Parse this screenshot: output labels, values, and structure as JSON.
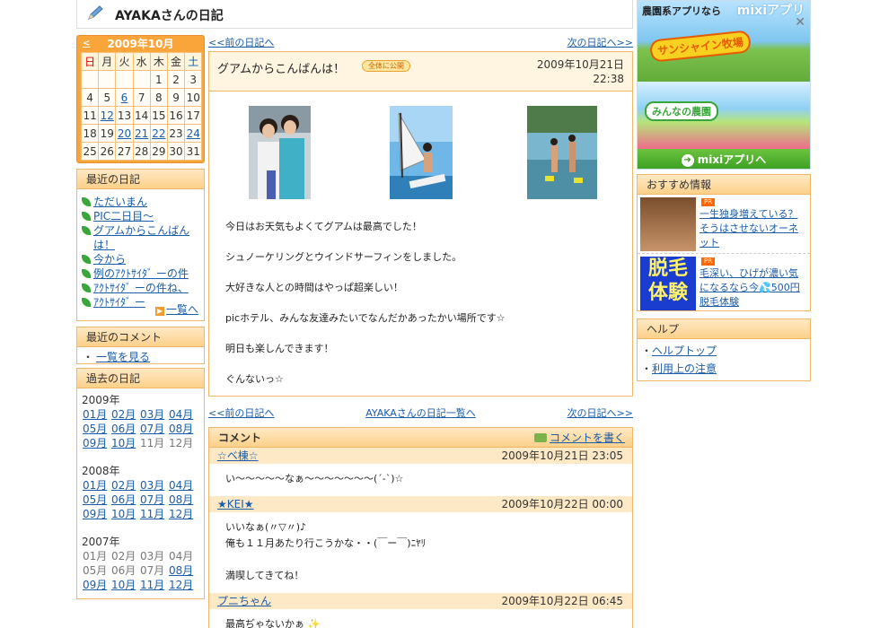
{
  "header": {
    "title": "AYAKAさんの日記"
  },
  "calendar": {
    "prev": "<",
    "month_label": "2009年10月",
    "weekdays": [
      "日",
      "月",
      "火",
      "水",
      "木",
      "金",
      "土"
    ],
    "rows": [
      [
        "",
        "",
        "",
        "",
        "1",
        "2",
        "3"
      ],
      [
        "4",
        "5",
        "6",
        "7",
        "8",
        "9",
        "10"
      ],
      [
        "11",
        "12",
        "13",
        "14",
        "15",
        "16",
        "17"
      ],
      [
        "18",
        "19",
        "20",
        "21",
        "22",
        "23",
        "24"
      ],
      [
        "25",
        "26",
        "27",
        "28",
        "29",
        "30",
        "31"
      ]
    ],
    "linked_days": [
      "6",
      "12",
      "20",
      "21",
      "22",
      "24"
    ]
  },
  "recent_diaries": {
    "title": "最近の日記",
    "items": [
      "ただいまん",
      "PIC二日目〜",
      "グアムからこんばんは！",
      "今から",
      "例のｱｸﾄｻｲﾀﾞ ーの件",
      "ｱｸﾄｻｲﾀﾞ ーの件ね、",
      "ｱｸﾄｻｲﾀﾞ ー"
    ],
    "more": "一覧を見る",
    "more_short": "一覧へ"
  },
  "recent_comments": {
    "title": "最近のコメント",
    "link": "一覧を見る",
    "bullet": "・"
  },
  "past_diaries": {
    "title": "過去の日記",
    "years": [
      {
        "year": "2009年",
        "months": [
          {
            "m": "01月",
            "on": true
          },
          {
            "m": "02月",
            "on": true
          },
          {
            "m": "03月",
            "on": true
          },
          {
            "m": "04月",
            "on": true
          },
          {
            "m": "05月",
            "on": true
          },
          {
            "m": "06月",
            "on": true
          },
          {
            "m": "07月",
            "on": true
          },
          {
            "m": "08月",
            "on": true
          },
          {
            "m": "09月",
            "on": true
          },
          {
            "m": "10月",
            "on": true
          },
          {
            "m": "11月",
            "on": false
          },
          {
            "m": "12月",
            "on": false
          }
        ]
      },
      {
        "year": "2008年",
        "months": [
          {
            "m": "01月",
            "on": true
          },
          {
            "m": "02月",
            "on": true
          },
          {
            "m": "03月",
            "on": true
          },
          {
            "m": "04月",
            "on": true
          },
          {
            "m": "05月",
            "on": true
          },
          {
            "m": "06月",
            "on": true
          },
          {
            "m": "07月",
            "on": true
          },
          {
            "m": "08月",
            "on": true
          },
          {
            "m": "09月",
            "on": true
          },
          {
            "m": "10月",
            "on": true
          },
          {
            "m": "11月",
            "on": true
          },
          {
            "m": "12月",
            "on": true
          }
        ]
      },
      {
        "year": "2007年",
        "months": [
          {
            "m": "01月",
            "on": false
          },
          {
            "m": "02月",
            "on": false
          },
          {
            "m": "03月",
            "on": false
          },
          {
            "m": "04月",
            "on": false
          },
          {
            "m": "05月",
            "on": false
          },
          {
            "m": "06月",
            "on": false
          },
          {
            "m": "07月",
            "on": false
          },
          {
            "m": "08月",
            "on": true
          },
          {
            "m": "09月",
            "on": true
          },
          {
            "m": "10月",
            "on": true
          },
          {
            "m": "11月",
            "on": true
          },
          {
            "m": "12月",
            "on": true
          }
        ]
      }
    ]
  },
  "nav": {
    "prev": "<<前の日記へ",
    "next": "次の日記へ>>",
    "list": "AYAKAさんの日記一覧へ"
  },
  "entry": {
    "title": "グアムからこんばんは！",
    "badge": "全体に公開",
    "date": "2009年10月21日",
    "time": "22:38",
    "paragraphs": [
      "今日はお天気もよくてグアムは最高でした！",
      "シュノーケリングとウインドサーフィンをしました。",
      "大好きな人との時間はやっぱ超楽しい！",
      "picホテル、みんな友達みたいでなんだかあったかい場所です☆",
      "明日も楽しんできます！",
      "ぐんないっ☆"
    ]
  },
  "comments": {
    "title": "コメント",
    "write": "コメントを書く",
    "items": [
      {
        "author": "☆ベ棟☆",
        "date": "2009年10月21日 23:05",
        "lines": [
          "い〜〜〜〜〜なぁ〜〜〜〜〜〜〜(´-`)☆"
        ]
      },
      {
        "author": "★KEI★",
        "date": "2009年10月22日 00:00",
        "lines": [
          "いいなぁ(〃▽〃)♪",
          "俺も１１月あたり行こうかな・・(￣ー￣)ﾆﾔﾘ",
          "",
          "満喫してきてね！"
        ]
      },
      {
        "author": "プニちゃん",
        "date": "2009年10月22日 06:45",
        "lines": [
          "最高ぢゃないかぁ ✨"
        ]
      }
    ]
  },
  "ad": {
    "heading": "農園系アプリなら",
    "logo": "mixiアプリ",
    "game1": "サンシャイン牧場",
    "game2": "みんなの農園",
    "button": "mixiアプリへ"
  },
  "reco": {
    "title": "おすすめ情報",
    "pr": "PR",
    "items": [
      {
        "text": "一生独身増えている？そうはさせないオーネット"
      },
      {
        "thumb": "脱毛体験",
        "text": "毛深い、ひげが濃い気になるなら今💦500円脱毛体験"
      }
    ]
  },
  "help": {
    "title": "ヘルプ",
    "bullet": "・",
    "items": [
      "ヘルプトップ",
      "利用上の注意"
    ]
  },
  "colors": {
    "accent": "#f9a53a",
    "link": "#1a5dab",
    "box_border": "#f0b768",
    "comment_bar": "#fde9c6"
  }
}
